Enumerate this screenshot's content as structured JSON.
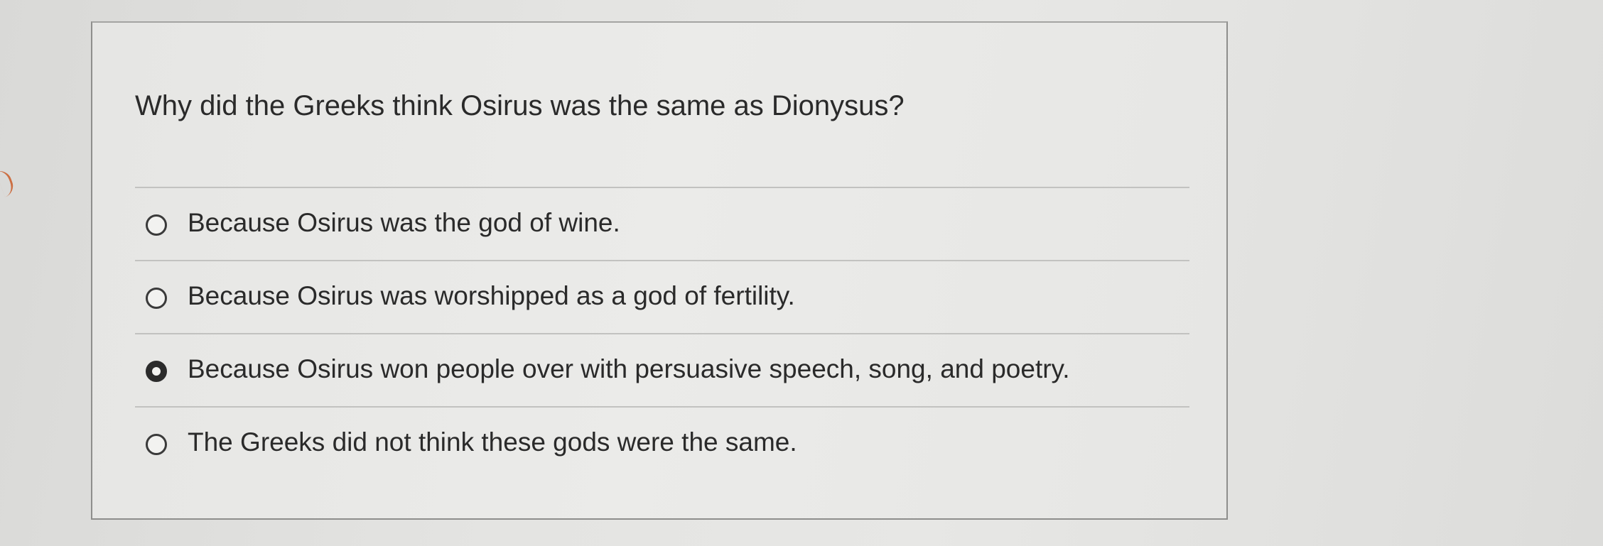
{
  "question": {
    "text": "Why did the Greeks think Osirus was the same as Dionysus?"
  },
  "answers": [
    {
      "label": "Because Osirus was the god of wine.",
      "selected": false
    },
    {
      "label": "Because Osirus was worshipped as a god of fertility.",
      "selected": false
    },
    {
      "label": "Because Osirus won people over with persuasive speech, song, and poetry.",
      "selected": true
    },
    {
      "label": "The Greeks did not think these gods were the same.",
      "selected": false
    }
  ],
  "colors": {
    "background": "#e4e4e2",
    "card_border": "#8e8e8c",
    "divider": "#c2c2c0",
    "text": "#2a2a2a"
  }
}
